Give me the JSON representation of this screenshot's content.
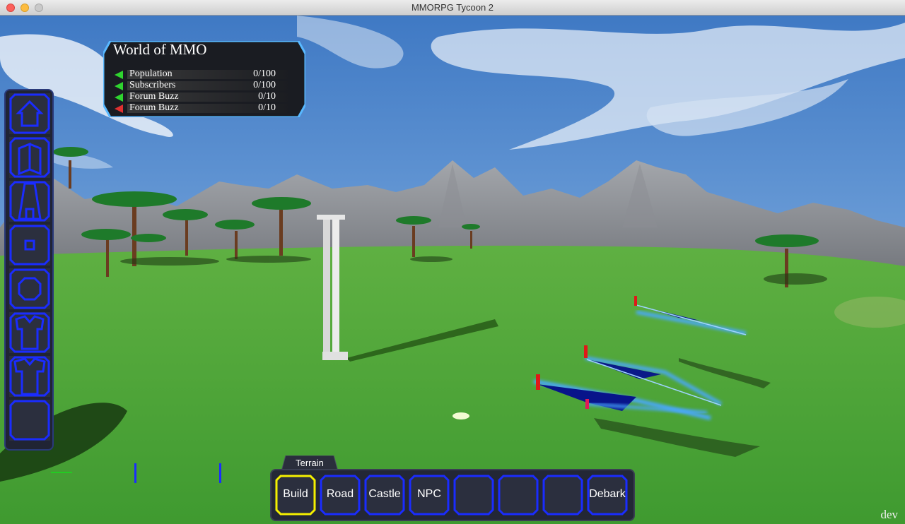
{
  "window": {
    "title": "MMORPG Tycoon 2"
  },
  "status_panel": {
    "title": "World of MMO",
    "stats": [
      {
        "label": "Population",
        "value": "0/100",
        "trend_color": "#2fd42f"
      },
      {
        "label": "Subscribers",
        "value": "0/100",
        "trend_color": "#2fd42f"
      },
      {
        "label": "Forum Buzz",
        "value": "0/10",
        "trend_color": "#2fd42f"
      },
      {
        "label": "Forum Buzz",
        "value": "0/10",
        "trend_color": "#e03030"
      }
    ]
  },
  "side_toolbar": {
    "items": [
      {
        "icon": "house-icon"
      },
      {
        "icon": "book-icon"
      },
      {
        "icon": "tower-icon"
      },
      {
        "icon": "square-icon"
      },
      {
        "icon": "octagon-icon"
      },
      {
        "icon": "armor-icon"
      },
      {
        "icon": "shirt-icon"
      },
      {
        "icon": "empty-slot"
      }
    ]
  },
  "bottom_toolbar": {
    "tab_label": "Terrain",
    "buttons": [
      {
        "label": "Build",
        "selected": true
      },
      {
        "label": "Road",
        "selected": false
      },
      {
        "label": "Castle",
        "selected": false
      },
      {
        "label": "NPC",
        "selected": false
      },
      {
        "label": "",
        "selected": false
      },
      {
        "label": "",
        "selected": false
      },
      {
        "label": "",
        "selected": false
      },
      {
        "label": "Debark",
        "selected": false
      }
    ]
  },
  "build_label": "dev",
  "colors": {
    "accent_blue": "#1a2cff",
    "selected_yellow": "#f5f000",
    "panel_glow": "#5ab8ff",
    "grass": "#4fa83a",
    "sky": "#5f92d2"
  }
}
